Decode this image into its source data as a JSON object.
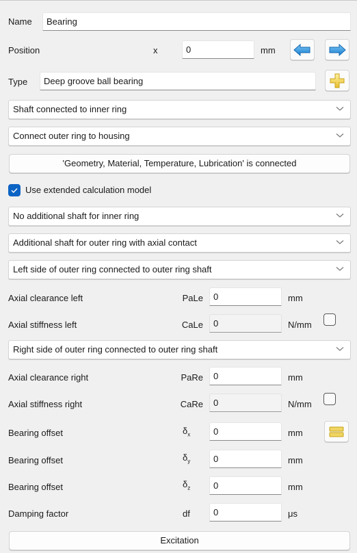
{
  "name": {
    "label": "Name",
    "value": "Bearing"
  },
  "position": {
    "label": "Position",
    "symbol": "x",
    "value": "0",
    "unit": "mm",
    "prev_button": "arrow-left-icon",
    "next_button": "arrow-right-icon"
  },
  "type": {
    "label": "Type",
    "value": "Deep groove ball bearing",
    "add_button": "plus-icon"
  },
  "combos": {
    "shaft_connection": "Shaft connected to inner ring",
    "outer_ring_connection": "Connect outer ring to housing"
  },
  "connected_button": "'Geometry, Material, Temperature, Lubrication' is connected",
  "extended_model": {
    "label": "Use extended calculation model",
    "checked": true
  },
  "combos2": {
    "inner_ring_shaft": "No additional shaft for inner ring",
    "outer_ring_shaft": "Additional shaft for outer ring with axial contact",
    "left_side": "Left side of outer ring connected to outer ring shaft",
    "right_side": "Right side of outer ring connected to outer ring shaft"
  },
  "rows": {
    "axial_clearance_left": {
      "label": "Axial clearance left",
      "symbol": "PaLe",
      "value": "0",
      "unit": "mm"
    },
    "axial_stiffness_left": {
      "label": "Axial stiffness left",
      "symbol": "CaLe",
      "value": "0",
      "unit": "N/mm",
      "checked": false
    },
    "axial_clearance_right": {
      "label": "Axial clearance right",
      "symbol": "PaRe",
      "value": "0",
      "unit": "mm"
    },
    "axial_stiffness_right": {
      "label": "Axial stiffness right",
      "symbol": "CaRe",
      "value": "0",
      "unit": "N/mm",
      "checked": false
    },
    "offset_x": {
      "label": "Bearing offset",
      "symbol": "δ",
      "sub": "x",
      "value": "0",
      "unit": "mm"
    },
    "offset_y": {
      "label": "Bearing offset",
      "symbol": "δ",
      "sub": "y",
      "value": "0",
      "unit": "mm"
    },
    "offset_z": {
      "label": "Bearing offset",
      "symbol": "δ",
      "sub": "z",
      "value": "0",
      "unit": "mm"
    },
    "damping": {
      "label": "Damping factor",
      "symbol": "df",
      "value": "0",
      "unit": "μs"
    }
  },
  "excitation_button": "Excitation",
  "colors": {
    "accent": "#0b63c4",
    "arrow_blue": "#2e95e0",
    "icon_yellow": "#f2d45a"
  }
}
